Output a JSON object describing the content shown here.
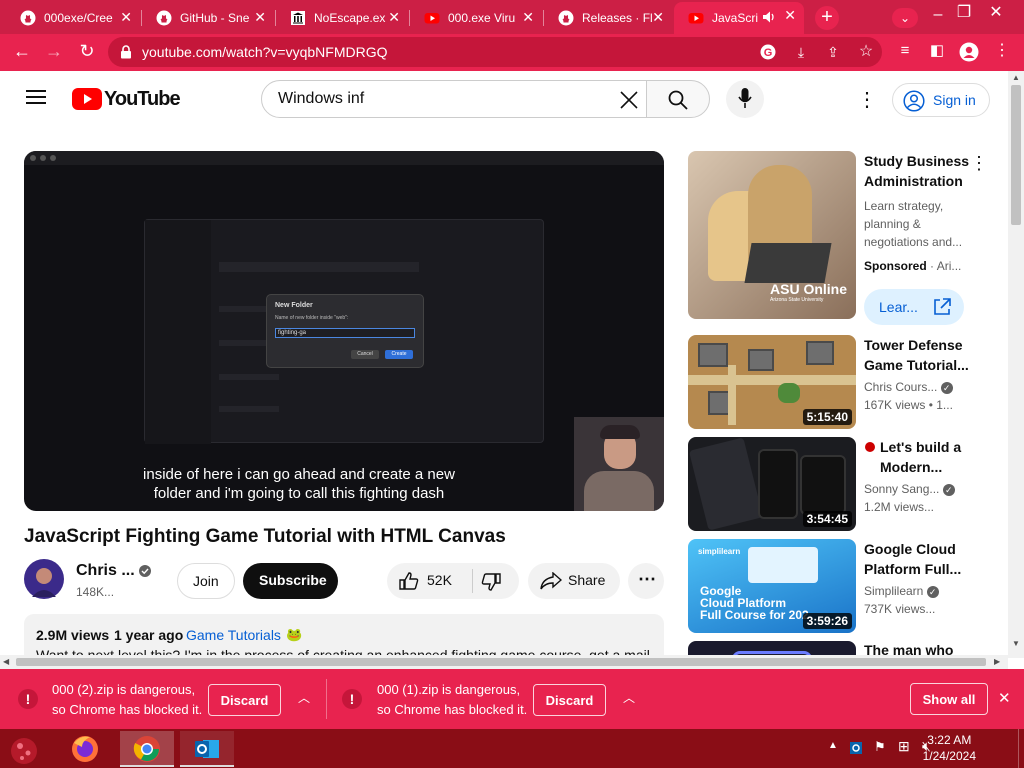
{
  "browser": {
    "tabs": [
      {
        "title": "000exe/Cree",
        "icon": "github-icon"
      },
      {
        "title": "GitHub - Sne",
        "icon": "github-icon"
      },
      {
        "title": "NoEscape.ex",
        "icon": "museum-icon"
      },
      {
        "title": "000.exe Viru",
        "icon": "youtube-icon"
      },
      {
        "title": "Releases · Fl",
        "icon": "github-icon"
      },
      {
        "title": "JavaScri",
        "icon": "youtube-icon"
      }
    ],
    "url": "youtube.com/watch?v=vyqbNFMDRGQ",
    "accent": "#e8234f"
  },
  "youtube": {
    "logo": "YouTube",
    "search_value": "Windows inf",
    "sign_in": "Sign in"
  },
  "player": {
    "caption_line1": "inside of here i can go ahead and create a new",
    "caption_line2": "folder and i'm going to call this fighting dash",
    "dialog_title": "New Folder",
    "dialog_prompt": "Name of new folder inside \"web\":",
    "dialog_value": "fighting-ga",
    "dialog_cancel": "Cancel",
    "dialog_create": "Create"
  },
  "video": {
    "title": "JavaScript Fighting Game Tutorial with HTML Canvas",
    "channel": "Chris ...",
    "subscribers": "148K...",
    "join": "Join",
    "subscribe": "Subscribe",
    "likes": "52K",
    "share": "Share",
    "views": "2.9M views",
    "age": "1 year ago",
    "tag": "Game Tutorials",
    "desc_preview": "Want to next level this? I'm in the process of creating an enhanced fighting game course, get a mail"
  },
  "recommendations": [
    {
      "title": "Study Business Administration",
      "meta1": "Learn strategy,",
      "meta2": "planning &",
      "meta3": "negotiations and...",
      "sponsored": "Sponsored",
      "advertiser": "Ari...",
      "cta": "Lear...",
      "thumb_text": "ASU Online",
      "thumb_sub": "Arizona State University"
    },
    {
      "title": "Tower Defense Game Tutorial...",
      "channel": "Chris Cours...",
      "views": "167K views",
      "age": "1...",
      "duration": "5:15:40"
    },
    {
      "title": "Let's build a Modern...",
      "channel": "Sonny Sang...",
      "views": "1.2M views...",
      "duration": "3:54:45"
    },
    {
      "title": "Google Cloud Platform Full...",
      "channel": "Simplilearn",
      "views": "737K views...",
      "duration": "3:59:26",
      "thumb_brand": "simplilearn",
      "thumb_line1": "Google",
      "thumb_line2": "Cloud Platform",
      "thumb_line3": "Full Course for 202"
    },
    {
      "title": "The man who"
    }
  ],
  "downloads": [
    {
      "line1": "000 (2).zip is dangerous,",
      "line2": "so Chrome has blocked it.",
      "action": "Discard"
    },
    {
      "line1": "000 (1).zip is dangerous,",
      "line2": "so Chrome has blocked it.",
      "action": "Discard"
    }
  ],
  "download_show_all": "Show all",
  "taskbar": {
    "time": "3:22 AM",
    "date": "1/24/2024"
  }
}
